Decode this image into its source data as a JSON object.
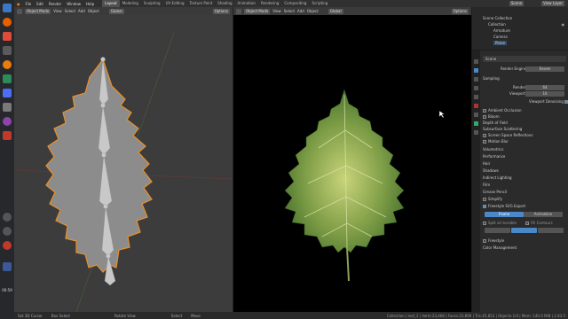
{
  "dock": {
    "clock": "00:59"
  },
  "topbar": {
    "menus": [
      "File",
      "Edit",
      "Render",
      "Window",
      "Help"
    ],
    "workspaces": [
      "Layout",
      "Modeling",
      "Sculpting",
      "UV Editing",
      "Texture Paint",
      "Shading",
      "Animation",
      "Rendering",
      "Compositing",
      "Scripting"
    ],
    "active_workspace": "Layout",
    "scene": "Scene",
    "view_layer": "View Layer"
  },
  "viewport_left": {
    "mode": "Object Mode",
    "menus": [
      "View",
      "Select",
      "Add",
      "Object"
    ],
    "orientation": "Global",
    "options": "Options"
  },
  "viewport_right": {
    "mode": "Object Mode",
    "menus": [
      "View",
      "Select",
      "Add",
      "Object"
    ],
    "orientation": "Global",
    "options": "Options"
  },
  "outliner": {
    "root": "Scene Collection",
    "items": [
      "Collection",
      "Armature",
      "Camera",
      "Plane"
    ]
  },
  "properties": {
    "scene": "Scene",
    "render_engine_label": "Render Engine",
    "render_engine": "Eevee",
    "sampling": "Sampling",
    "render_label": "Render",
    "render_samples": "64",
    "viewport_label": "Viewport",
    "viewport_samples": "16",
    "viewport_denoising": "Viewport Denoising",
    "panels": [
      "Ambient Occlusion",
      "Bloom",
      "Depth of Field",
      "Subsurface Scattering",
      "Screen Space Reflections",
      "Motion Blur",
      "Volumetrics",
      "Performance",
      "Hair",
      "Shadows",
      "Indirect Lighting",
      "Film",
      "Grease Pencil",
      "Simplify",
      "Freestyle SVG Export"
    ],
    "svg_mode_a": "Frame",
    "svg_mode_b": "Animation",
    "split_by_material": "Split at Invisible",
    "fill_contours": "Fill Contours",
    "freestyle": "Freestyle",
    "color_management": "Color Management"
  },
  "status": {
    "items": [
      "Set 3D Cursor",
      "Box Select",
      "Rotate View",
      "Select",
      "Move"
    ],
    "info": "Collection | leaf_2 | Verts:23,466 | Faces:22,890 | Tris:45,852 | Objects:1/4 | Mem: 140.0 MiB | 2.83.5"
  },
  "colors": {
    "accent": "#4a88c7",
    "selection_outline": "#e8902a",
    "leaf_light": "#c9d47a",
    "leaf_dark": "#3f6b2a"
  }
}
